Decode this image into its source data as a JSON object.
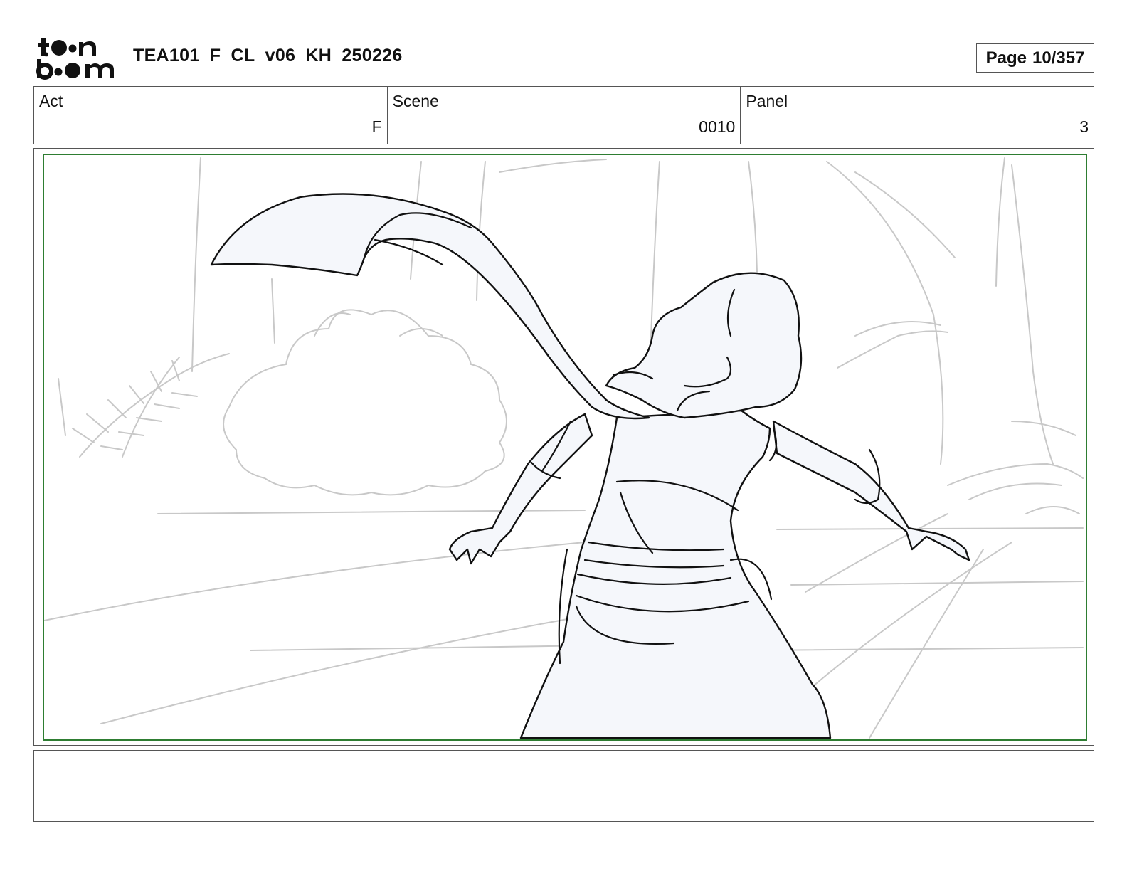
{
  "header": {
    "logo_text": "toon boom",
    "document_title": "TEA101_F_CL_v06_KH_250226",
    "page_label": "Page",
    "page_value": "10/357"
  },
  "info": {
    "act_label": "Act",
    "act_value": "F",
    "scene_label": "Scene",
    "scene_value": "0010",
    "panel_label": "Panel",
    "panel_value": "3"
  },
  "panel": {
    "safe_frame_color": "#2e7d32",
    "sketch_line_color": "#111111",
    "background_line_color": "#c8c8c8",
    "character_fill": "#f5f7fb"
  },
  "notes": {
    "text": ""
  }
}
